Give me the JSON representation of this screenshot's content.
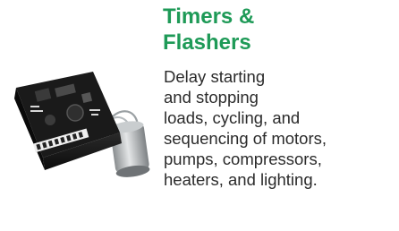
{
  "product": {
    "title": "Timers &\nFlashers",
    "description": "Delay starting\nand stopping\nloads, cycling, and\nsequencing of motors,\npumps, compressors,\nheaters, and lighting.",
    "image_icon": "timer-module-photo"
  },
  "colors": {
    "title": "#1e9a57",
    "body_text": "#2b2b2b",
    "background": "#ffffff"
  }
}
